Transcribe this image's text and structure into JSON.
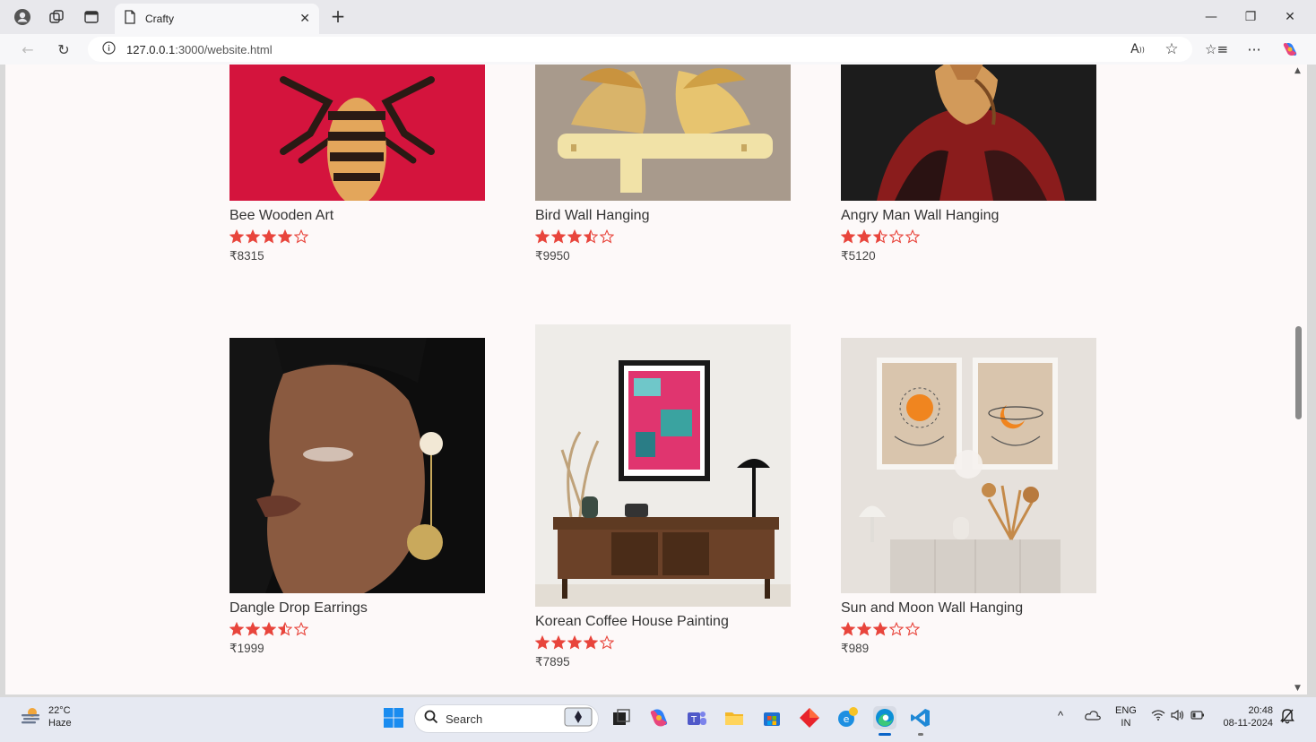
{
  "browser": {
    "tab_title": "Crafty",
    "url_host": "127.0.0.1",
    "url_path": ":3000/website.html"
  },
  "products": [
    {
      "name": "Bee Wooden Art",
      "rating": 4,
      "price": "₹8315"
    },
    {
      "name": "Bird Wall Hanging",
      "rating": 3.5,
      "price": "₹9950"
    },
    {
      "name": "Angry Man Wall Hanging",
      "rating": 2.5,
      "price": "₹5120"
    },
    {
      "name": "Dangle Drop Earrings",
      "rating": 3.5,
      "price": "₹1999"
    },
    {
      "name": "Korean Coffee House Painting",
      "rating": 4,
      "price": "₹7895"
    },
    {
      "name": "Sun and Moon Wall Hanging",
      "rating": 3,
      "price": "₹989"
    }
  ],
  "colors": {
    "star": "#e8453c",
    "page_bg": "#fdf9f9"
  },
  "taskbar": {
    "temperature": "22°C",
    "weather": "Haze",
    "search_label": "Search",
    "lang_top": "ENG",
    "lang_bottom": "IN",
    "time": "20:48",
    "date": "08-11-2024"
  }
}
